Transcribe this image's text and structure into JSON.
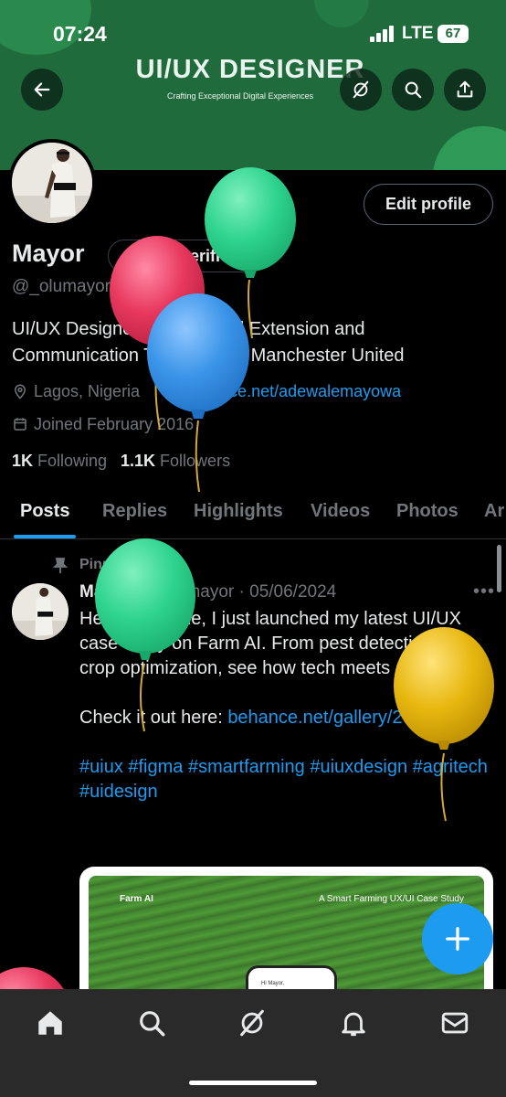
{
  "status_bar": {
    "time": "07:24",
    "network": "LTE",
    "battery": "67"
  },
  "banner": {
    "title": "UI/UX DESIGNER",
    "subtitle": "Crafting Exceptional Digital Experiences"
  },
  "header_actions": [
    "back-arrow-icon",
    "grok-icon",
    "search-icon",
    "share-icon"
  ],
  "profile": {
    "edit_button": "Edit profile",
    "name": "Mayor",
    "verify_label": "Get verified",
    "handle": "@_olumayor",
    "bio": "UI/UX Designer | Agricultural Extension and Communication Technology | Manchester United",
    "location": "Lagos, Nigeria",
    "website": "behance.net/adewalemayowa",
    "joined": "Joined February 2016",
    "following_count": "1K",
    "following_label": "Following",
    "followers_count": "1.1K",
    "followers_label": "Followers"
  },
  "tabs": [
    {
      "label": "Posts",
      "active": true
    },
    {
      "label": "Replies",
      "active": false
    },
    {
      "label": "Highlights",
      "active": false
    },
    {
      "label": "Videos",
      "active": false
    },
    {
      "label": "Photos",
      "active": false
    },
    {
      "label": "Ar",
      "active": false
    }
  ],
  "post": {
    "pinned_label": "Pinned",
    "author": "Mayor",
    "handle": "@_olumayor",
    "date": "05/06/2024",
    "more_label": "•••",
    "text": "Hello everyone, I just launched my latest UI/UX case study on Farm AI. From pest detection to crop optimization, see how tech meets agriculture.",
    "cta_text": "Check it out here:",
    "cta_link": "behance.net/gallery/200216...",
    "hashtags": "#uiux #figma #smartfarming #uiuxdesign #agritech #uidesign",
    "media": {
      "brand": "Farm AI",
      "caption": "A Smart Farming UX/UI Case Study",
      "phone_text": "Hi Mayor,"
    }
  },
  "fab_label": "+",
  "bottom_nav": [
    "home-icon",
    "search-icon",
    "grok-icon",
    "notifications-icon",
    "messages-icon"
  ],
  "colors": {
    "banner_green": "#1f6b3c",
    "accent_blue": "#1d9bf0",
    "muted_text": "#71767b",
    "nav_bg": "#2b2a2a",
    "balloon_green": "#2fd48f",
    "balloon_blue": "#3b95e8",
    "balloon_red": "#e8385e",
    "balloon_yellow": "#e8b810"
  }
}
